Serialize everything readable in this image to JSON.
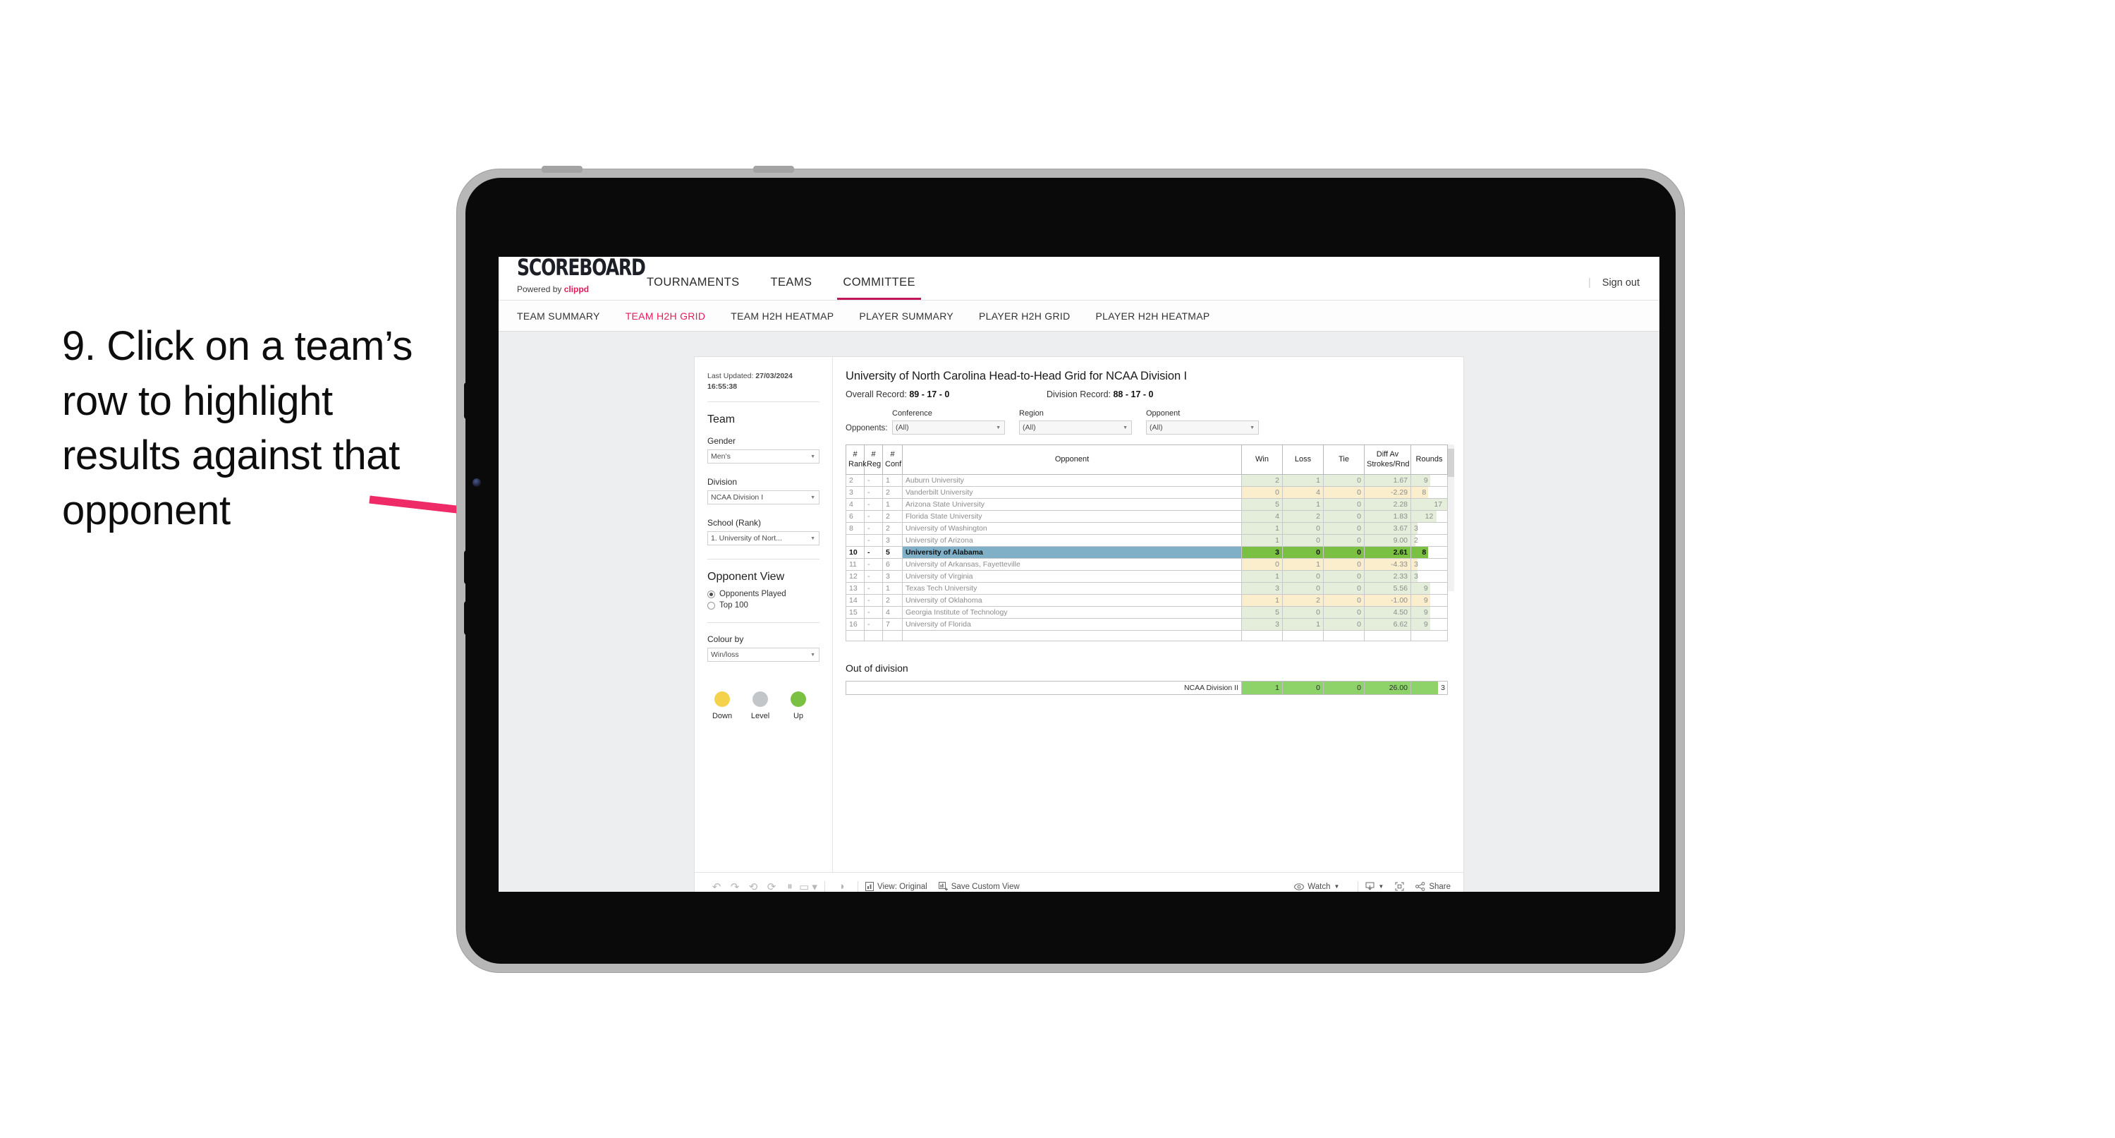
{
  "annotation": {
    "text": "9. Click on a team’s row to highlight results against that opponent",
    "arrow_color": "#ee2a67"
  },
  "topnav": {
    "logo": "SCOREBOARD",
    "powered_prefix": "Powered by ",
    "powered_brand": "clippd",
    "links": [
      {
        "label": "TOURNAMENTS",
        "active": false
      },
      {
        "label": "TEAMS",
        "active": false
      },
      {
        "label": "COMMITTEE",
        "active": true
      }
    ],
    "signout_label": "Sign out",
    "signout_divider": "|"
  },
  "subnav": {
    "links": [
      {
        "label": "TEAM SUMMARY",
        "active": false
      },
      {
        "label": "TEAM H2H GRID",
        "active": true
      },
      {
        "label": "TEAM H2H HEATMAP",
        "active": false
      },
      {
        "label": "PLAYER SUMMARY",
        "active": false
      },
      {
        "label": "PLAYER H2H GRID",
        "active": false
      },
      {
        "label": "PLAYER H2H HEATMAP",
        "active": false
      }
    ]
  },
  "sidebar": {
    "last_updated_label": "Last Updated: ",
    "last_updated_value": "27/03/2024 16:55:38",
    "team_heading": "Team",
    "gender_label": "Gender",
    "gender_value": "Men’s",
    "division_label": "Division",
    "division_value": "NCAA Division I",
    "school_label": "School (Rank)",
    "school_value": "1. University of Nort...",
    "opponent_view_heading": "Opponent View",
    "opponent_view_options": [
      {
        "label": "Opponents Played",
        "selected": true
      },
      {
        "label": "Top 100",
        "selected": false
      }
    ],
    "colour_by_label": "Colour by",
    "colour_by_value": "Win/loss",
    "legend": [
      {
        "label": "Down",
        "color": "#f5d24b"
      },
      {
        "label": "Level",
        "color": "#c3c6c8"
      },
      {
        "label": "Up",
        "color": "#7ac143"
      }
    ]
  },
  "main": {
    "title": "University of North Carolina Head-to-Head Grid for NCAA Division I",
    "overall_record_label": "Overall Record: ",
    "overall_record_value": "89 - 17 - 0",
    "division_record_label": "Division Record: ",
    "division_record_value": "88 - 17 - 0",
    "opponents_label": "Opponents:",
    "filters": [
      {
        "label": "Conference",
        "value": "(All)"
      },
      {
        "label": "Region",
        "value": "(All)"
      },
      {
        "label": "Opponent",
        "value": "(All)"
      }
    ],
    "out_of_division_title": "Out of division"
  },
  "chart_data": {
    "type": "table",
    "title": "University of North Carolina Head-to-Head Grid for NCAA Division I",
    "columns": [
      "# Rank",
      "# Reg",
      "# Conf",
      "Opponent",
      "Win",
      "Loss",
      "Tie",
      "Diff Av Strokes/Rnd",
      "Rounds"
    ],
    "rounds_max": 17,
    "rows": [
      {
        "rank": "2",
        "reg": "-",
        "conf": "1",
        "opponent": "Auburn University",
        "win": "2",
        "loss": "1",
        "tie": "0",
        "diff": "1.67",
        "rounds": "9",
        "rounds_n": 9,
        "color": "up",
        "selected": false
      },
      {
        "rank": "3",
        "reg": "-",
        "conf": "2",
        "opponent": "Vanderbilt University",
        "win": "0",
        "loss": "4",
        "tie": "0",
        "diff": "-2.29",
        "rounds": "8",
        "rounds_n": 8,
        "color": "down",
        "selected": false
      },
      {
        "rank": "4",
        "reg": "-",
        "conf": "1",
        "opponent": "Arizona State University",
        "win": "5",
        "loss": "1",
        "tie": "0",
        "diff": "2.28",
        "rounds": "17",
        "rounds_n": 17,
        "color": "up",
        "selected": false
      },
      {
        "rank": "6",
        "reg": "-",
        "conf": "2",
        "opponent": "Florida State University",
        "win": "4",
        "loss": "2",
        "tie": "0",
        "diff": "1.83",
        "rounds": "12",
        "rounds_n": 12,
        "color": "up",
        "selected": false
      },
      {
        "rank": "8",
        "reg": "-",
        "conf": "2",
        "opponent": "University of Washington",
        "win": "1",
        "loss": "0",
        "tie": "0",
        "diff": "3.67",
        "rounds": "3",
        "rounds_n": 3,
        "color": "up",
        "selected": false
      },
      {
        "rank": "",
        "reg": "-",
        "conf": "3",
        "opponent": "University of Arizona",
        "win": "1",
        "loss": "0",
        "tie": "0",
        "diff": "9.00",
        "rounds": "2",
        "rounds_n": 2,
        "color": "up",
        "selected": false
      },
      {
        "rank": "10",
        "reg": "-",
        "conf": "5",
        "opponent": "University of Alabama",
        "win": "3",
        "loss": "0",
        "tie": "0",
        "diff": "2.61",
        "rounds": "8",
        "rounds_n": 8,
        "color": "up",
        "selected": true
      },
      {
        "rank": "11",
        "reg": "-",
        "conf": "6",
        "opponent": "University of Arkansas, Fayetteville",
        "win": "0",
        "loss": "1",
        "tie": "0",
        "diff": "-4.33",
        "rounds": "3",
        "rounds_n": 3,
        "color": "down",
        "selected": false
      },
      {
        "rank": "12",
        "reg": "-",
        "conf": "3",
        "opponent": "University of Virginia",
        "win": "1",
        "loss": "0",
        "tie": "0",
        "diff": "2.33",
        "rounds": "3",
        "rounds_n": 3,
        "color": "up",
        "selected": false
      },
      {
        "rank": "13",
        "reg": "-",
        "conf": "1",
        "opponent": "Texas Tech University",
        "win": "3",
        "loss": "0",
        "tie": "0",
        "diff": "5.56",
        "rounds": "9",
        "rounds_n": 9,
        "color": "up",
        "selected": false
      },
      {
        "rank": "14",
        "reg": "-",
        "conf": "2",
        "opponent": "University of Oklahoma",
        "win": "1",
        "loss": "2",
        "tie": "0",
        "diff": "-1.00",
        "rounds": "9",
        "rounds_n": 9,
        "color": "down",
        "selected": false
      },
      {
        "rank": "15",
        "reg": "-",
        "conf": "4",
        "opponent": "Georgia Institute of Technology",
        "win": "5",
        "loss": "0",
        "tie": "0",
        "diff": "4.50",
        "rounds": "9",
        "rounds_n": 9,
        "color": "up",
        "selected": false
      },
      {
        "rank": "16",
        "reg": "-",
        "conf": "7",
        "opponent": "University of Florida",
        "win": "3",
        "loss": "1",
        "tie": "0",
        "diff": "6.62",
        "rounds": "9",
        "rounds_n": 9,
        "color": "up",
        "selected": false
      }
    ],
    "out_of_division": {
      "label": "NCAA Division II",
      "win": "1",
      "loss": "0",
      "tie": "0",
      "diff": "26.00",
      "rounds": "3",
      "rounds_n": 3,
      "rounds_max": 4
    }
  },
  "toolbar": {
    "view_label": "View: Original",
    "save_label": "Save Custom View",
    "watch_label": "Watch",
    "share_label": "Share"
  }
}
